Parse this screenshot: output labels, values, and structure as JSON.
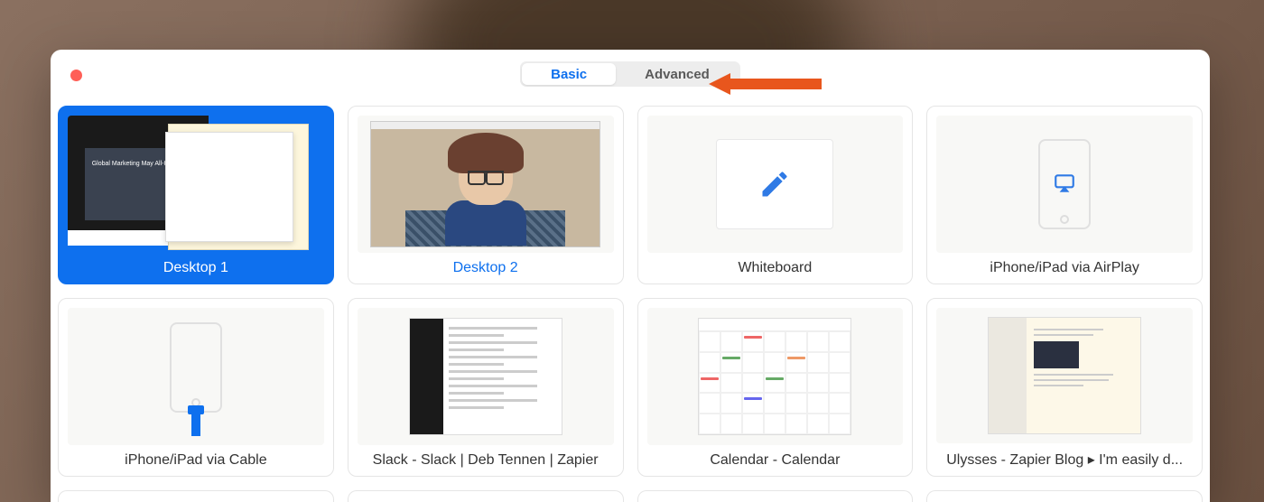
{
  "segmented": {
    "basic": "Basic",
    "advanced": "Advanced",
    "active": "basic"
  },
  "annotation": {
    "arrow_target": "advanced-tab",
    "arrow_color": "#e8561d"
  },
  "sources": [
    {
      "id": "desktop1",
      "label": "Desktop 1",
      "kind": "desktop",
      "selected": true
    },
    {
      "id": "desktop2",
      "label": "Desktop 2",
      "kind": "desktop",
      "selected": false
    },
    {
      "id": "whiteboard",
      "label": "Whiteboard",
      "kind": "tool",
      "selected": false
    },
    {
      "id": "airplay",
      "label": "iPhone/iPad via AirPlay",
      "kind": "device",
      "selected": false
    },
    {
      "id": "cable",
      "label": "iPhone/iPad via Cable",
      "kind": "device",
      "selected": false
    },
    {
      "id": "slack",
      "label": "Slack - Slack | Deb Tennen | Zapier",
      "kind": "app",
      "selected": false
    },
    {
      "id": "calendar",
      "label": "Calendar - Calendar",
      "kind": "app",
      "selected": false
    },
    {
      "id": "ulysses",
      "label": "Ulysses - Zapier Blog ▸ I'm easily d...",
      "kind": "app",
      "selected": false
    }
  ],
  "desktop1_preview": {
    "slide_text": "Global Marketing\nMay All-Hands"
  }
}
